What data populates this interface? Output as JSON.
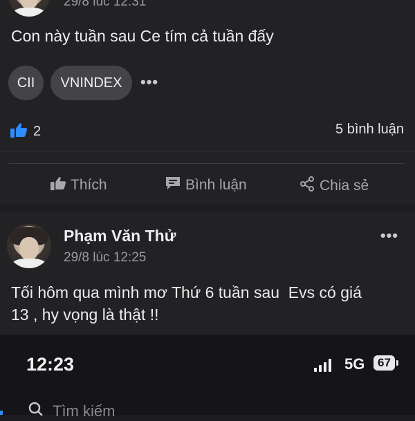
{
  "post1": {
    "time": "29/8 lúc 12:31",
    "text": "Con này tuần sau Ce tím cả tuần đấy",
    "tags": [
      "CII",
      "VNINDEX"
    ],
    "more_label": "•••",
    "like_count": "2",
    "comments_label": "5 bình luận",
    "actions": {
      "like": "Thích",
      "comment": "Bình luận",
      "share": "Chia sẻ"
    },
    "accent_color": "#2f8cff"
  },
  "post2": {
    "author": "Phạm Văn Thử",
    "time": "29/8 lúc 12:25",
    "text_line1": "Tối hôm qua mình mơ Thứ 6 tuần sau  Evs có giá",
    "text_line2": "13 , hy vọng là thật !!",
    "more_label": "•••"
  },
  "status_bar": {
    "time": "12:23",
    "network": "5G",
    "battery": "67"
  },
  "search": {
    "placeholder": "Tìm kiếm"
  }
}
